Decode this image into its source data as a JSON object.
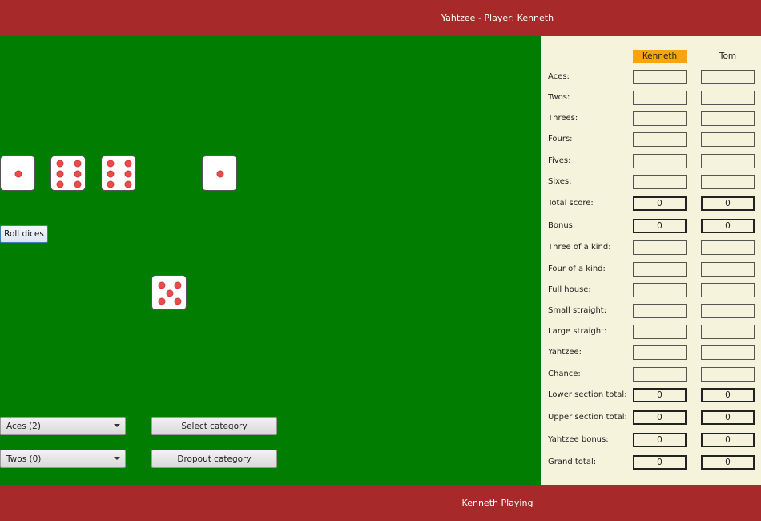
{
  "window": {
    "title": "Yahtzee - Player: Kenneth"
  },
  "status": {
    "text": "Kenneth Playing"
  },
  "dice": [
    {
      "value": 1
    },
    {
      "value": 6
    },
    {
      "value": 6
    },
    {
      "value": 1
    },
    {
      "value": 5
    }
  ],
  "controls": {
    "roll_label": "Roll dices",
    "select_category_label": "Select category",
    "dropout_category_label": "Dropout category",
    "select_category_choice": "Aces (2)",
    "dropout_category_choice": "Twos (0)"
  },
  "scorecard": {
    "players": [
      {
        "name": "Kenneth",
        "active": true
      },
      {
        "name": "Tom",
        "active": false
      }
    ],
    "rows": [
      {
        "label": "Aces:",
        "kind": "score",
        "values": [
          "",
          ""
        ]
      },
      {
        "label": "Twos:",
        "kind": "score",
        "values": [
          "",
          ""
        ]
      },
      {
        "label": "Threes:",
        "kind": "score",
        "values": [
          "",
          ""
        ]
      },
      {
        "label": "Fours:",
        "kind": "score",
        "values": [
          "",
          ""
        ]
      },
      {
        "label": "Fives:",
        "kind": "score",
        "values": [
          "",
          ""
        ]
      },
      {
        "label": "Sixes:",
        "kind": "score",
        "values": [
          "",
          ""
        ]
      },
      {
        "label": "Total score:",
        "kind": "total",
        "values": [
          "0",
          "0"
        ]
      },
      {
        "label": "Bonus:",
        "kind": "total",
        "values": [
          "0",
          "0"
        ]
      },
      {
        "label": "Three of a kind:",
        "kind": "score",
        "values": [
          "",
          ""
        ]
      },
      {
        "label": "Four of a kind:",
        "kind": "score",
        "values": [
          "",
          ""
        ]
      },
      {
        "label": "Full house:",
        "kind": "score",
        "values": [
          "",
          ""
        ]
      },
      {
        "label": "Small straight:",
        "kind": "score",
        "values": [
          "",
          ""
        ]
      },
      {
        "label": "Large straight:",
        "kind": "score",
        "values": [
          "",
          ""
        ]
      },
      {
        "label": "Yahtzee:",
        "kind": "score",
        "values": [
          "",
          ""
        ]
      },
      {
        "label": "Chance:",
        "kind": "score",
        "values": [
          "",
          ""
        ]
      },
      {
        "label": "Lower section total:",
        "kind": "total",
        "values": [
          "0",
          "0"
        ]
      },
      {
        "label": "Upper section total:",
        "kind": "total",
        "values": [
          "0",
          "0"
        ]
      },
      {
        "label": "Yahtzee bonus:",
        "kind": "total",
        "values": [
          "0",
          "0"
        ]
      },
      {
        "label": "Grand total:",
        "kind": "total",
        "values": [
          "0",
          "0"
        ]
      }
    ]
  }
}
